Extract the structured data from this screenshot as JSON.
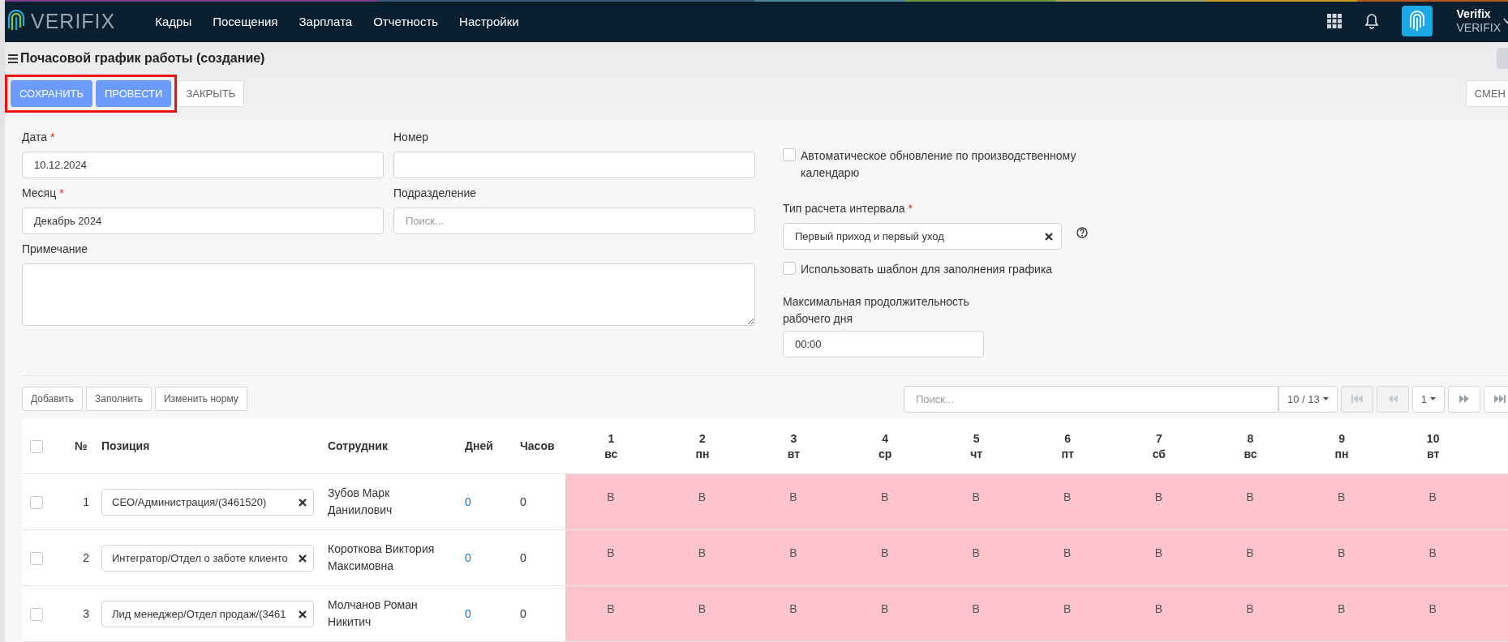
{
  "nav": {
    "logo": "VERIFIX",
    "menu": [
      "Кадры",
      "Посещения",
      "Зарплата",
      "Отчетность",
      "Настройки"
    ],
    "user": {
      "name": "Verifix",
      "company": "VERIFIX"
    }
  },
  "page": {
    "title": "Почасовой график работы (создание)"
  },
  "toolbar": {
    "highlight_primary": true,
    "buttons": [
      {
        "label": "СОХРАНИТЬ",
        "kind": "primary"
      },
      {
        "label": "ПРОВЕСТИ",
        "kind": "primary"
      },
      {
        "label": "ЗАКРЫТЬ",
        "kind": "default"
      }
    ],
    "right_button": "СМЕН"
  },
  "form": {
    "date": {
      "label": "Дата",
      "required_mark": "*",
      "value": "10.12.2024"
    },
    "number": {
      "label": "Номер"
    },
    "month": {
      "label": "Месяц",
      "required_mark": "*",
      "value": "Декабрь 2024"
    },
    "division": {
      "label": "Подразделение",
      "placeholder": "Поиск..."
    },
    "note": {
      "label": "Примечание"
    },
    "auto_update": {
      "label": "Автоматическое обновление по производственному календарю",
      "checked": false
    },
    "interval_type": {
      "label": "Тип расчета интервала",
      "required_mark": "*",
      "value": "Первый приход и первый уход"
    },
    "use_template": {
      "label": "Использовать шаблон для заполнения графика",
      "checked": false
    },
    "max_duration": {
      "label": "Максимальная продолжительность рабочего дня",
      "value": "00:00"
    }
  },
  "table_toolbar": {
    "buttons": [
      "Добавить",
      "Заполнить",
      "Изменить норму"
    ],
    "search": {
      "placeholder": "Поиск..."
    },
    "page_size": "10 / 13",
    "page": "1"
  },
  "table": {
    "all_checked": false,
    "columns": [
      "№",
      "Позиция",
      "Сотрудник",
      "Дней",
      "Часов"
    ],
    "days": [
      {
        "day": "1",
        "weekday": "вс"
      },
      {
        "day": "2",
        "weekday": "пн"
      },
      {
        "day": "3",
        "weekday": "вт"
      },
      {
        "day": "4",
        "weekday": "ср"
      },
      {
        "day": "5",
        "weekday": "чт"
      },
      {
        "day": "6",
        "weekday": "пт"
      },
      {
        "day": "7",
        "weekday": "сб"
      },
      {
        "day": "8",
        "weekday": "вс"
      },
      {
        "day": "9",
        "weekday": "пн"
      },
      {
        "day": "10",
        "weekday": "вт"
      }
    ],
    "rows": [
      {
        "checked": false,
        "number": "1",
        "position": "СЕО/Администрация/(3461520)",
        "employee": "Зубов Марк Даниилович",
        "days": "0",
        "hours": "0",
        "cells": [
          "В",
          "В",
          "В",
          "В",
          "В",
          "В",
          "В",
          "В",
          "В",
          "В"
        ]
      },
      {
        "checked": false,
        "number": "2",
        "position": "Интегратор/Отдел о заботе клиенто",
        "employee": "Короткова Виктория Максимовна",
        "days": "0",
        "hours": "0",
        "cells": [
          "В",
          "В",
          "В",
          "В",
          "В",
          "В",
          "В",
          "В",
          "В",
          "В"
        ]
      },
      {
        "checked": false,
        "number": "3",
        "position": "Лид менеджер/Отдел продаж/(3461",
        "employee": "Молчанов Роман Никитич",
        "days": "0",
        "hours": "0",
        "cells": [
          "В",
          "В",
          "В",
          "В",
          "В",
          "В",
          "В",
          "В",
          "В",
          "В"
        ]
      }
    ]
  }
}
